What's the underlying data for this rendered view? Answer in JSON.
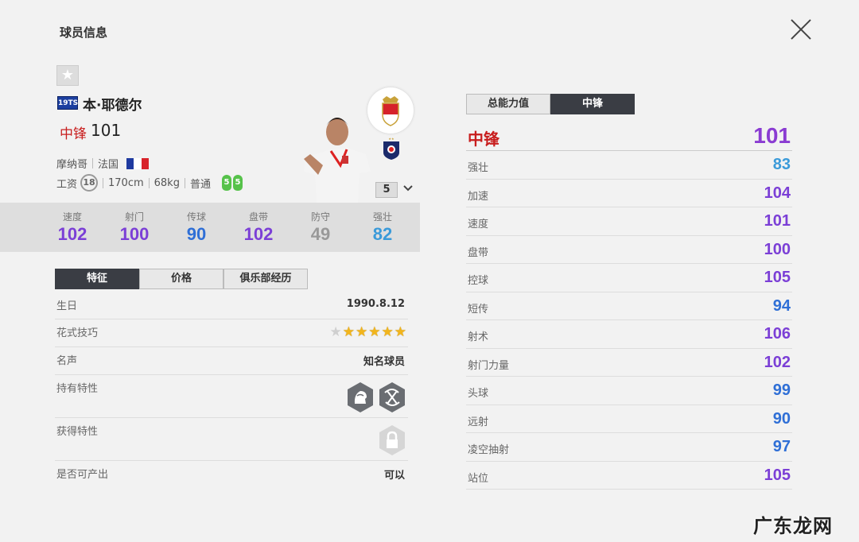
{
  "window": {
    "title": "球员信息"
  },
  "player": {
    "season_badge": "19TS",
    "name": "本·耶德尔",
    "position": "中锋",
    "overall": "101",
    "club": "摩纳哥",
    "nation": "法国",
    "wage_label": "工资",
    "wage": "18",
    "height": "170cm",
    "weight": "68kg",
    "body_type": "普通",
    "weak_foot_left": "5",
    "weak_foot_right": "5",
    "upgrade_level": "5"
  },
  "summary_stats": [
    {
      "label": "速度",
      "value": "102",
      "color": "#7b3fd6"
    },
    {
      "label": "射门",
      "value": "100",
      "color": "#7b3fd6"
    },
    {
      "label": "传球",
      "value": "90",
      "color": "#2f6fd6"
    },
    {
      "label": "盘带",
      "value": "102",
      "color": "#7b3fd6"
    },
    {
      "label": "防守",
      "value": "49",
      "color": "#999999"
    },
    {
      "label": "强壮",
      "value": "82",
      "color": "#3a9ad9"
    }
  ],
  "info_tabs": [
    "特征",
    "价格",
    "俱乐部经历"
  ],
  "info": {
    "birthday_label": "生日",
    "birthday": "1990.8.12",
    "skill_label": "花式技巧",
    "skill_stars": 5,
    "reputation_label": "名声",
    "reputation": "知名球员",
    "traits_label": "持有特性",
    "acquired_label": "获得特性",
    "producible_label": "是否可产出",
    "producible": "可以"
  },
  "right_tabs": [
    "总能力值",
    "中锋"
  ],
  "right_header": {
    "label": "中锋",
    "value": "101"
  },
  "attributes": [
    {
      "label": "强壮",
      "value": "83",
      "color": "#3a9ad9"
    },
    {
      "label": "加速",
      "value": "104",
      "color": "#7b3fd6"
    },
    {
      "label": "速度",
      "value": "101",
      "color": "#7b3fd6"
    },
    {
      "label": "盘带",
      "value": "100",
      "color": "#7b3fd6"
    },
    {
      "label": "控球",
      "value": "105",
      "color": "#7b3fd6"
    },
    {
      "label": "短传",
      "value": "94",
      "color": "#2f6fd6"
    },
    {
      "label": "射术",
      "value": "106",
      "color": "#7b3fd6"
    },
    {
      "label": "射门力量",
      "value": "102",
      "color": "#7b3fd6"
    },
    {
      "label": "头球",
      "value": "99",
      "color": "#2f6fd6"
    },
    {
      "label": "远射",
      "value": "90",
      "color": "#2f6fd6"
    },
    {
      "label": "凌空抽射",
      "value": "97",
      "color": "#2f6fd6"
    },
    {
      "label": "站位",
      "value": "105",
      "color": "#7b3fd6"
    }
  ],
  "watermark": "广东龙网"
}
